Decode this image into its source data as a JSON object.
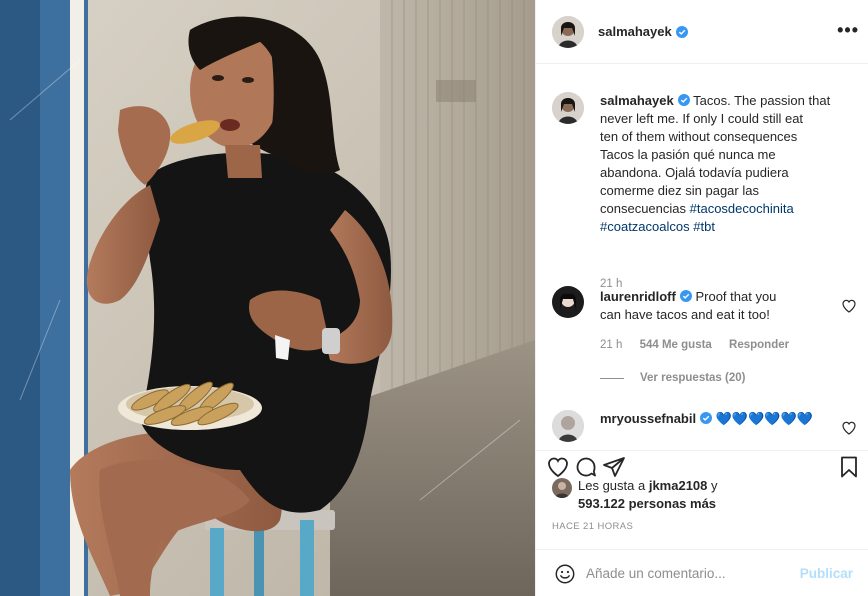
{
  "post": {
    "author": "salmahayek",
    "more_label": "•••",
    "photo_alt": "Woman eating tacos on a stool",
    "caption": {
      "user": "salmahayek",
      "line1": "Tacos. The passion that",
      "line2": "never left me. If only I could still eat",
      "line3": "ten of them without consequences",
      "line4": "Tacos la pasión qué nunca me",
      "line5": "abandona. Ojalá todavía pudiera",
      "line6": "comerme diez sin pagar las",
      "line7": "consecuencias",
      "tag1": "#tacosdecochinita",
      "tag2": "#coatzacoalcos",
      "tag3": "#tbt",
      "time": "21 h"
    }
  },
  "comments": [
    {
      "user": "laurenridloff",
      "line1": "Proof that you",
      "line2": "can have tacos and eat it too!",
      "time": "21 h",
      "likes": "544 Me gusta",
      "reply": "Responder",
      "view_replies": "Ver respuestas (20)"
    },
    {
      "user": "mryoussefnabil",
      "text": "💙💙💙💙💙💙"
    }
  ],
  "likes": {
    "prefix": "Les gusta a ",
    "user": "jkma2108",
    "middle": " y",
    "count": "593.122 personas más"
  },
  "timestamp": "HACE 21 HORAS",
  "comment_box": {
    "placeholder": "Añade un comentario...",
    "publish": "Publicar"
  },
  "colors": {
    "link": "#00376b",
    "verified": "#3897f0",
    "publish_disabled": "#b2dffc",
    "emoji_heart": "#1ec8d2"
  }
}
